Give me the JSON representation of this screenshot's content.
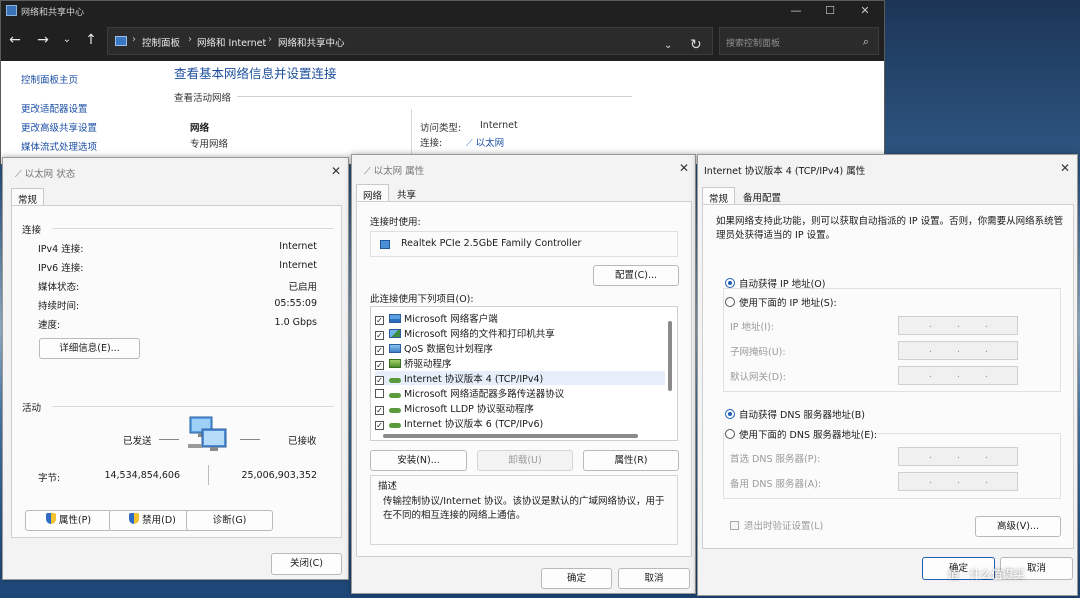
{
  "control_panel": {
    "window_title": "网络和共享中心",
    "breadcrumb": [
      "控制面板",
      "网络和 Internet",
      "网络和共享中心"
    ],
    "search_placeholder": "搜索控制面板",
    "sidebar": [
      "控制面板主页",
      "更改适配器设置",
      "更改高级共享设置",
      "媒体流式处理选项"
    ],
    "headline": "查看基本网络信息并设置连接",
    "active_networks_label": "查看活动网络",
    "network_name": "网络",
    "network_type": "专用网络",
    "access_type_label": "访问类型:",
    "access_type_value": "Internet",
    "connection_label": "连接:",
    "connection_value": "以太网"
  },
  "status_dialog": {
    "title": "以太网 状态",
    "tab": "常规",
    "connection_section": "连接",
    "rows": [
      {
        "label": "IPv4 连接:",
        "value": "Internet"
      },
      {
        "label": "IPv6 连接:",
        "value": "Internet"
      },
      {
        "label": "媒体状态:",
        "value": "已启用"
      },
      {
        "label": "持续时间:",
        "value": "05:55:09"
      },
      {
        "label": "速度:",
        "value": "1.0 Gbps"
      }
    ],
    "details_button": "详细信息(E)...",
    "activity_section": "活动",
    "sent_label": "已发送",
    "received_label": "已接收",
    "bytes_label": "字节:",
    "bytes_sent": "14,534,854,606",
    "bytes_received": "25,006,903,352",
    "properties_button": "属性(P)",
    "disable_button": "禁用(D)",
    "diagnose_button": "诊断(G)",
    "close_button": "关闭(C)"
  },
  "props_dialog": {
    "title": "以太网 属性",
    "tabs": [
      "网络",
      "共享"
    ],
    "connect_using_label": "连接时使用:",
    "adapter_name": "Realtek PCIe 2.5GbE Family Controller",
    "configure_button": "配置(C)...",
    "items_label": "此连接使用下列项目(O):",
    "items": [
      {
        "label": "Microsoft 网络客户端",
        "checked": true,
        "icon": "client"
      },
      {
        "label": "Microsoft 网络的文件和打印机共享",
        "checked": true,
        "icon": "share"
      },
      {
        "label": "QoS 数据包计划程序",
        "checked": true,
        "icon": "qos"
      },
      {
        "label": "桥驱动程序",
        "checked": true,
        "icon": "drv"
      },
      {
        "label": "Internet 协议版本 4 (TCP/IPv4)",
        "checked": true,
        "icon": "proto"
      },
      {
        "label": "Microsoft 网络适配器多路传送器协议",
        "checked": false,
        "icon": "proto"
      },
      {
        "label": "Microsoft LLDP 协议驱动程序",
        "checked": true,
        "icon": "proto"
      },
      {
        "label": "Internet 协议版本 6 (TCP/IPv6)",
        "checked": true,
        "icon": "proto"
      }
    ],
    "install_button": "安装(N)...",
    "uninstall_button": "卸载(U)",
    "properties_button": "属性(R)",
    "description_label": "描述",
    "description_text": "传输控制协议/Internet 协议。该协议是默认的广域网络协议，用于在不同的相互连接的网络上通信。",
    "ok_button": "确定",
    "cancel_button": "取消"
  },
  "ipv4_dialog": {
    "title": "Internet 协议版本 4 (TCP/IPv4) 属性",
    "tabs": [
      "常规",
      "备用配置"
    ],
    "intro": "如果网络支持此功能，则可以获取自动指派的 IP 设置。否则，你需要从网络系统管理员处获得适当的 IP 设置。",
    "auto_ip": "自动获得 IP 地址(O)",
    "manual_ip": "使用下面的 IP 地址(S):",
    "ip_address_label": "IP 地址(I):",
    "subnet_label": "子网掩码(U):",
    "gateway_label": "默认网关(D):",
    "auto_dns": "自动获得 DNS 服务器地址(B)",
    "manual_dns": "使用下面的 DNS 服务器地址(E):",
    "preferred_dns_label": "首选 DNS 服务器(P):",
    "alternate_dns_label": "备用 DNS 服务器(A):",
    "validate_label": "退出时验证设置(L)",
    "advanced_button": "高级(V)...",
    "ok_button": "确定",
    "cancel_button": "取消",
    "dot": "."
  },
  "watermark": "值 · 什么值得买",
  "colors": {
    "accent": "#1f5fb8",
    "link": "#1b4fa6",
    "titlebar_dark": "#202020"
  }
}
